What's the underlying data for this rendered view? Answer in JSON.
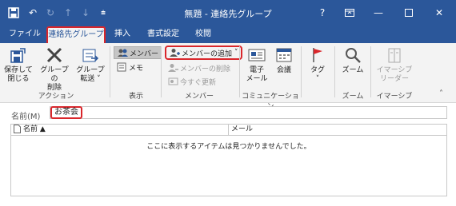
{
  "window": {
    "title": "無題 - 連絡先グループ",
    "help_label": "?"
  },
  "tabs": [
    {
      "label": "ファイル"
    },
    {
      "label": "連絡先グループ"
    },
    {
      "label": "挿入"
    },
    {
      "label": "書式設定"
    },
    {
      "label": "校閲"
    }
  ],
  "ribbon": {
    "groups": {
      "actions": {
        "label": "アクション",
        "save_close": {
          "line1": "保存して",
          "line2": "閉じる"
        },
        "delete_group": {
          "line1": "グループの",
          "line2": "削除"
        },
        "forward_group": {
          "line1": "グループ",
          "line2": "転送 ˅"
        }
      },
      "show": {
        "label": "表示",
        "members": "メンバー",
        "notes": "メモ"
      },
      "members": {
        "label": "メンバー",
        "add_members": "メンバーの追加",
        "remove_member": "メンバーの削除",
        "update_now": "今すぐ更新"
      },
      "communicate": {
        "label": "コミュニケーション",
        "email": {
          "line1": "電子",
          "line2": "メール"
        },
        "meeting": "会議"
      },
      "tags": {
        "tag_label": "タグ",
        "tag_arrow": "˅"
      },
      "zoom": {
        "label": "ズーム",
        "zoom_btn": "ズーム"
      },
      "immersive": {
        "label": "イマーシブ",
        "reader": {
          "line1": "イマーシブ",
          "line2": "リーダー"
        }
      }
    }
  },
  "form": {
    "name_label": "名前(M)",
    "name_value": "お茶会"
  },
  "member_list": {
    "col_name": "名前 ▲",
    "col_email": "メール",
    "empty_message": "ここに表示するアイテムは見つかりませんでした。"
  },
  "colors": {
    "titlebar": "#2b579a",
    "ribbon_bg": "#f3f3f3",
    "highlight": "#d9262b"
  }
}
